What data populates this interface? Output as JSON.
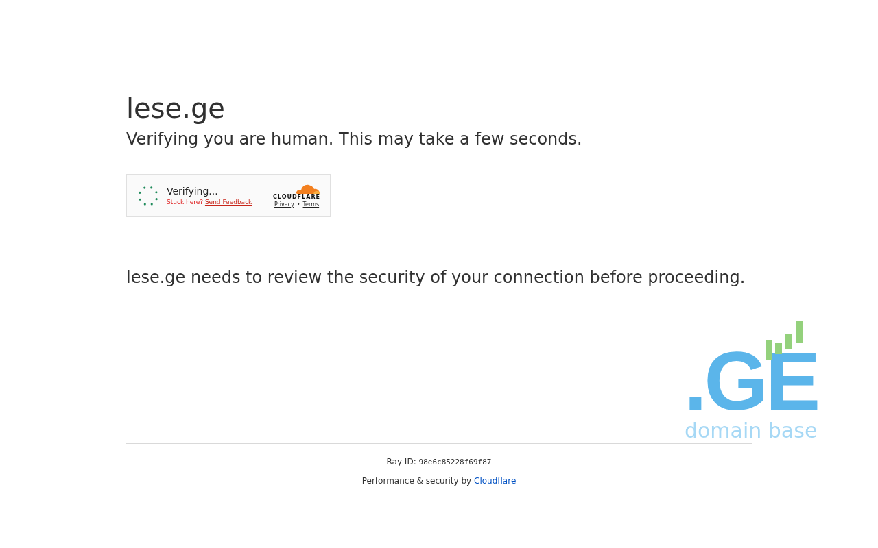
{
  "heading": "lese.ge",
  "subheading": "Verifying you are human. This may take a few seconds.",
  "widget": {
    "status": "Verifying...",
    "stuck": "Stuck here?",
    "feedback_link": "Send Feedback",
    "brand": "CLOUDFLARE",
    "privacy_link": "Privacy",
    "separator": "•",
    "terms_link": "Terms"
  },
  "message": "lese.ge needs to review the security of your connection before proceeding.",
  "logo": {
    "mark": ".GE",
    "tagline": "domain base"
  },
  "footer": {
    "ray_label": "Ray ID:",
    "ray_id": "98e6c85228f69f87",
    "performance": "Performance & security by",
    "cloudflare_link": "Cloudflare"
  }
}
